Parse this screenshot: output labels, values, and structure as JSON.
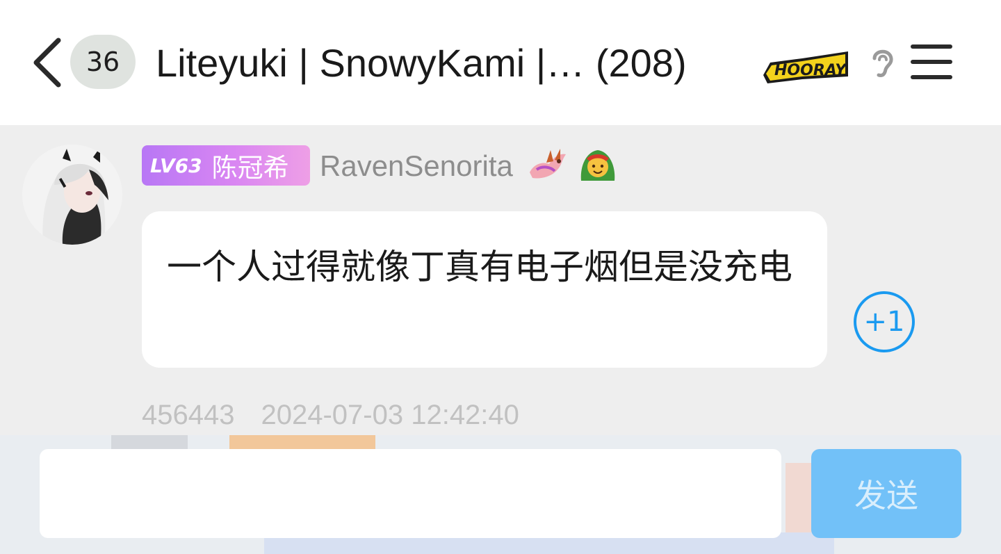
{
  "header": {
    "back_icon": "chevron-left-icon",
    "unread_count": "36",
    "title": "Liteyuki | SnowyKami |… (208)",
    "sticker_icon": "hooray-sticker-icon",
    "ear_icon": "ear-icon",
    "menu_icon": "hamburger-menu-icon"
  },
  "message": {
    "level": "LV63",
    "nickname": "陈冠希",
    "username": "RavenSenorita",
    "decorations": [
      "dragon-badge-icon",
      "green-hooded-emoji-icon"
    ],
    "text": "一个人过得就像丁真有电子烟但是没充电",
    "plus_one": "+1",
    "id": "456443",
    "timestamp": "2024-07-03 12:42:40"
  },
  "composer": {
    "input_value": "",
    "send_label": "发送"
  },
  "colors": {
    "chat_background": "#eeeeee",
    "accent_blue": "#1a9af0",
    "send_button": "#72c1f8",
    "level_tag_start": "#b877f5",
    "level_tag_end": "#ee9fe6"
  }
}
